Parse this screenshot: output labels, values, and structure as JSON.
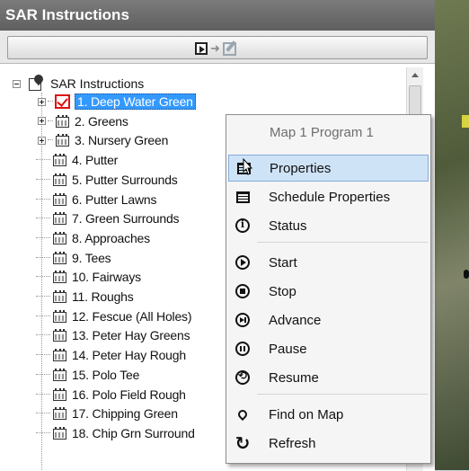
{
  "window": {
    "title": "SAR Instructions"
  },
  "tree": {
    "root_label": "SAR Instructions",
    "items": [
      {
        "label": "1. Deep Water Green",
        "selected": true,
        "expandable": true,
        "icon": "checklist-icon"
      },
      {
        "label": "2. Greens",
        "expandable": true,
        "icon": "calendar-icon"
      },
      {
        "label": "3. Nursery Green",
        "expandable": true,
        "icon": "calendar-icon"
      },
      {
        "label": "4. Putter",
        "icon": "calendar-icon"
      },
      {
        "label": "5. Putter Surrounds",
        "icon": "calendar-icon"
      },
      {
        "label": "6. Putter Lawns",
        "icon": "calendar-icon"
      },
      {
        "label": "7. Green Surrounds",
        "icon": "calendar-icon"
      },
      {
        "label": "8. Approaches",
        "icon": "calendar-icon"
      },
      {
        "label": "9. Tees",
        "icon": "calendar-icon"
      },
      {
        "label": "10. Fairways",
        "icon": "calendar-icon"
      },
      {
        "label": "11. Roughs",
        "icon": "calendar-icon"
      },
      {
        "label": "12. Fescue (All Holes)",
        "icon": "calendar-icon"
      },
      {
        "label": "13. Peter Hay Greens",
        "icon": "calendar-icon"
      },
      {
        "label": "14. Peter Hay Rough",
        "icon": "calendar-icon"
      },
      {
        "label": "15. Polo Tee",
        "icon": "calendar-icon"
      },
      {
        "label": "16. Polo Field Rough",
        "icon": "calendar-icon"
      },
      {
        "label": "17. Chipping Green",
        "icon": "calendar-icon"
      },
      {
        "label": "18. Chip Grn Surround",
        "icon": "calendar-icon"
      }
    ]
  },
  "context_menu": {
    "header": "Map 1 Program 1",
    "items": [
      {
        "label": "Properties",
        "icon": "properties-icon",
        "highlighted": true
      },
      {
        "label": "Schedule Properties",
        "icon": "schedule-properties-icon"
      },
      {
        "label": "Status",
        "icon": "info-icon"
      },
      {
        "label": "Start",
        "icon": "play-icon"
      },
      {
        "label": "Stop",
        "icon": "stop-icon"
      },
      {
        "label": "Advance",
        "icon": "advance-icon"
      },
      {
        "label": "Pause",
        "icon": "pause-icon"
      },
      {
        "label": "Resume",
        "icon": "resume-icon"
      },
      {
        "label": "Find on Map",
        "icon": "map-pin-icon"
      },
      {
        "label": "Refresh",
        "icon": "refresh-icon"
      }
    ]
  },
  "colors": {
    "selection": "#3399ff",
    "menu_highlight": "#cfe3f7",
    "check_red": "#dd1111"
  }
}
